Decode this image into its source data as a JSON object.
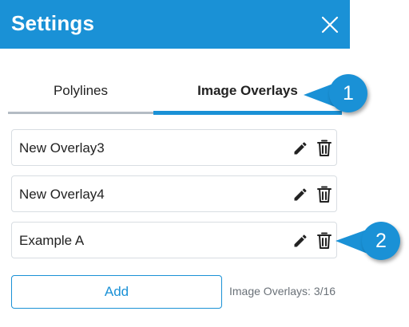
{
  "header": {
    "title": "Settings",
    "background_color": "#1a91d6",
    "close_icon": "close-icon"
  },
  "tabs": [
    {
      "label": "Polylines",
      "active": false
    },
    {
      "label": "Image Overlays",
      "active": true
    }
  ],
  "overlays": [
    {
      "name": "New Overlay3",
      "edit_icon": "pencil-icon",
      "delete_icon": "trash-icon"
    },
    {
      "name": "New Overlay4",
      "edit_icon": "pencil-icon",
      "delete_icon": "trash-icon"
    },
    {
      "name": "Example A",
      "edit_icon": "pencil-icon",
      "delete_icon": "trash-icon"
    }
  ],
  "footer": {
    "add_label": "Add",
    "count_text": "Image Overlays: 3/16"
  },
  "callouts": [
    {
      "number": "1"
    },
    {
      "number": "2"
    }
  ],
  "colors": {
    "accent": "#1a91d6",
    "inactive_underline": "#b4bcc4",
    "border": "#d8dde2"
  }
}
